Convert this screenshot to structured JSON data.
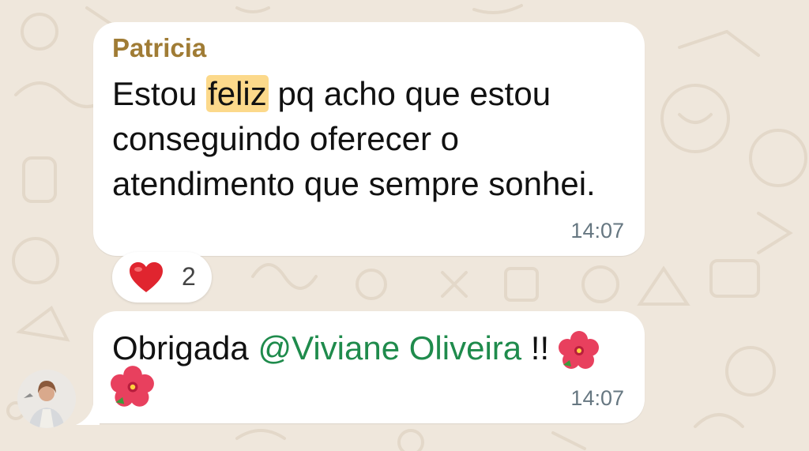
{
  "chat": {
    "messages": [
      {
        "sender": "Patricia",
        "text_before": "Estou ",
        "highlight": "feliz",
        "text_after": " pq acho que estou conseguindo oferecer o atendimento que sempre sonhei.",
        "time": "14:07",
        "reaction": {
          "emoji": "heart",
          "count": "2"
        }
      },
      {
        "text_before": "Obrigada ",
        "mention": "@Viviane Oliveira",
        "text_after": " !!",
        "emoji": [
          "hibiscus",
          "hibiscus"
        ],
        "time": "14:07"
      }
    ]
  },
  "colors": {
    "wallpaper": "#efe7dc",
    "bubble": "#ffffff",
    "sender_name": "#a07c35",
    "highlight": "#fcd98b",
    "mention": "#1f8b4c",
    "timestamp": "#667781"
  }
}
